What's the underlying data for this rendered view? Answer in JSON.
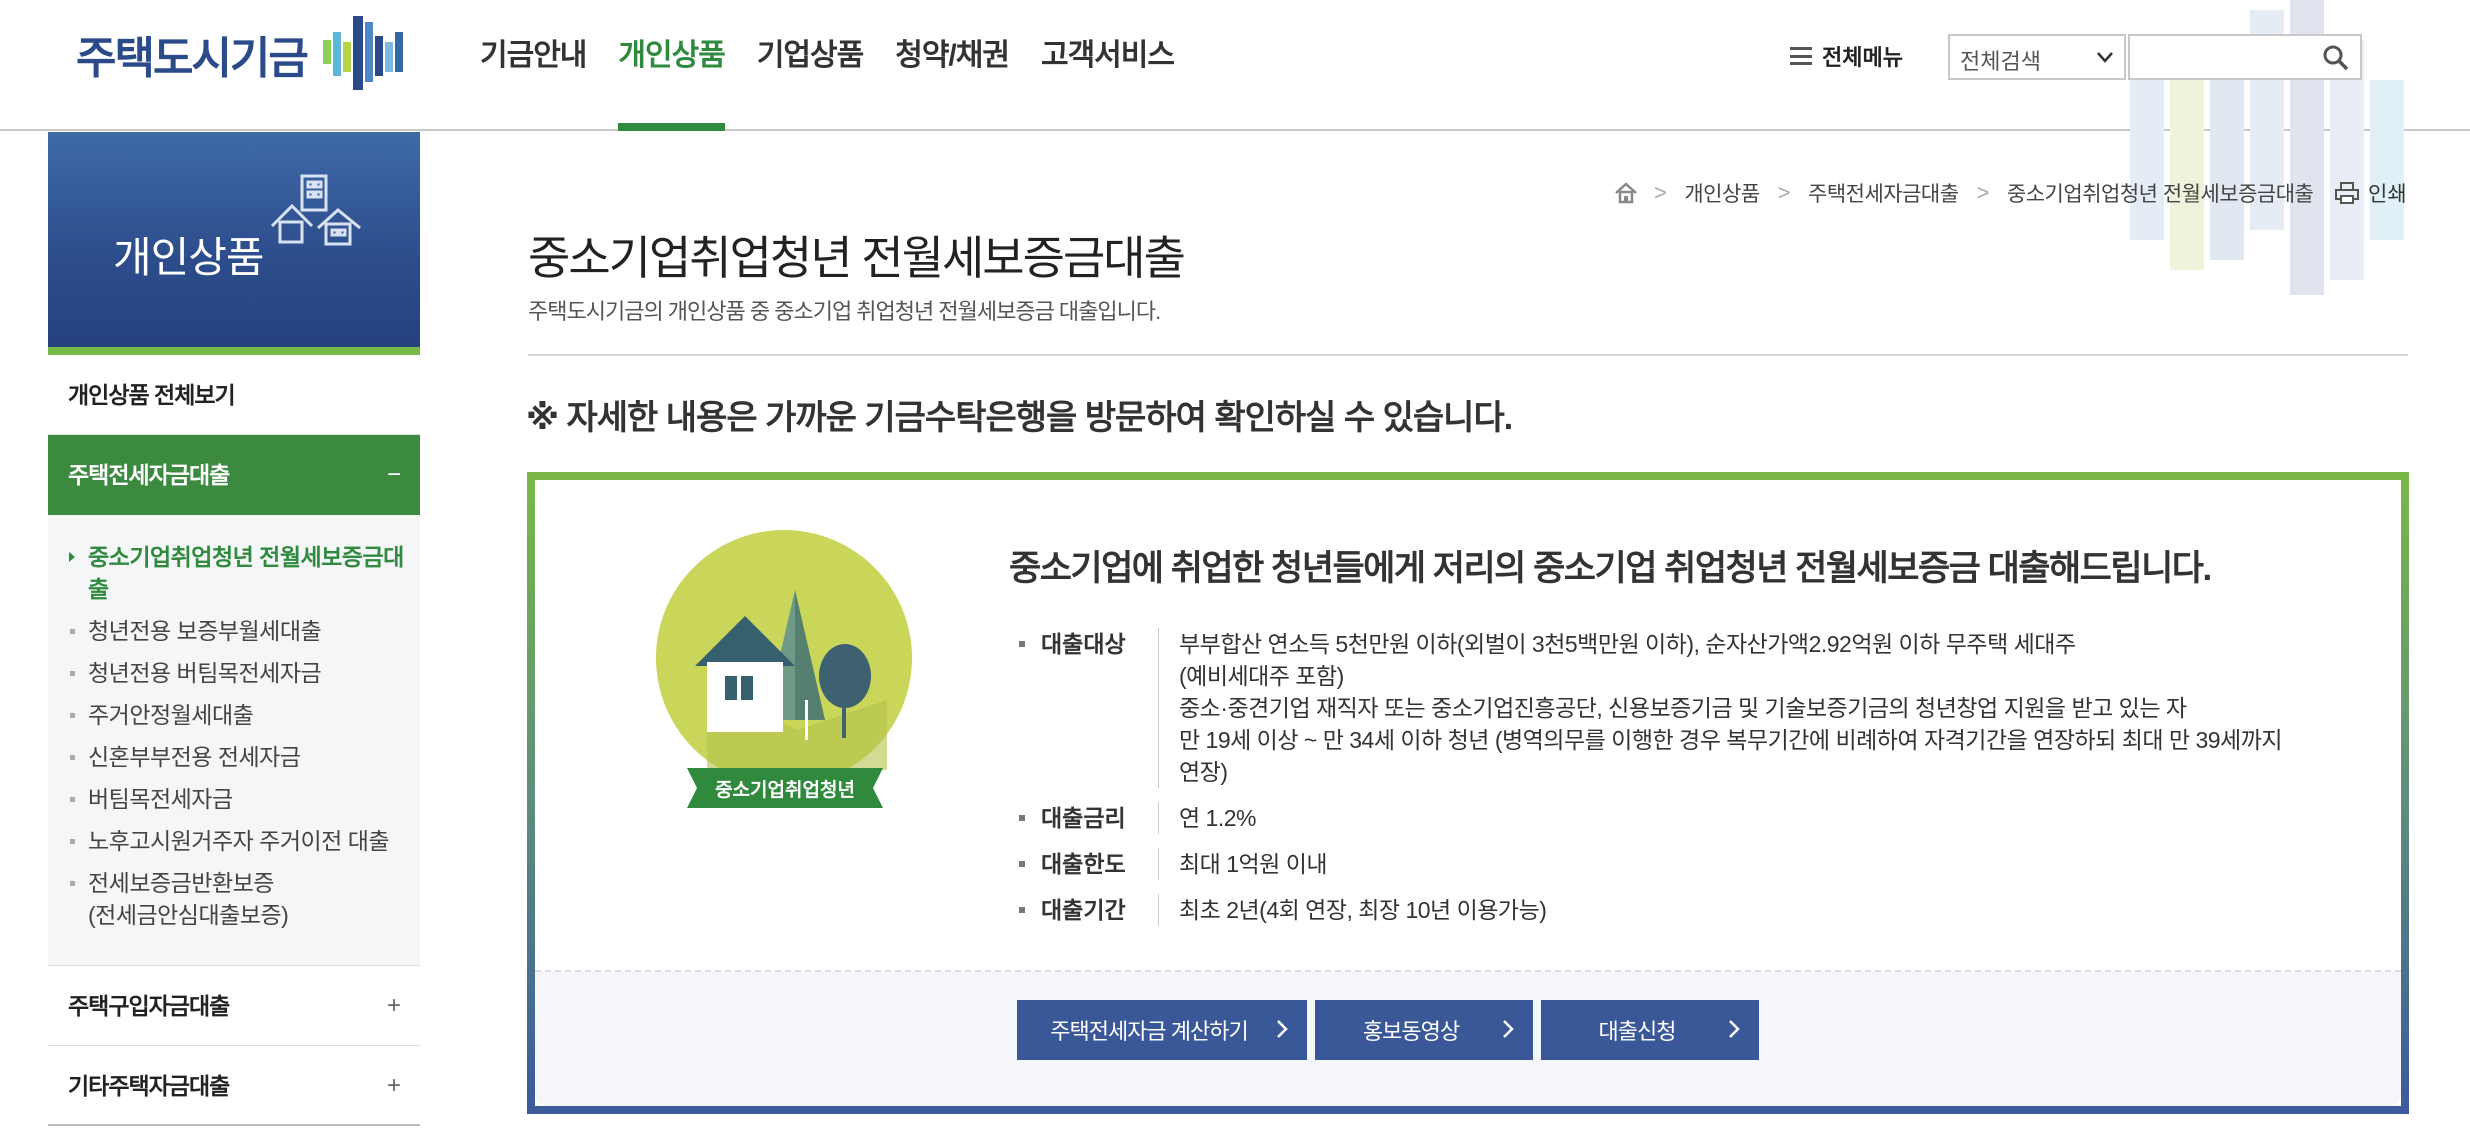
{
  "header": {
    "logo_text": "주택도시기금",
    "nav": [
      "기금안내",
      "개인상품",
      "기업상품",
      "청약/채권",
      "고객서비스"
    ],
    "active_nav": "개인상품",
    "all_menu_label": "전체메뉴",
    "search_select_value": "전체검색",
    "search_input_value": "",
    "icons": [
      "menu-icon",
      "chevron-down-icon",
      "search-icon"
    ]
  },
  "sidebar": {
    "title": "개인상품",
    "all_view": "개인상품 전체보기",
    "groups": [
      {
        "label": "주택전세자금대출",
        "sign": "−",
        "open": true,
        "items": [
          {
            "label": "중소기업취업청년 전월세보증금대출",
            "current": true
          },
          {
            "label": "청년전용 보증부월세대출"
          },
          {
            "label": "청년전용 버팀목전세자금"
          },
          {
            "label": "주거안정월세대출"
          },
          {
            "label": "신혼부부전용 전세자금"
          },
          {
            "label": "버팀목전세자금"
          },
          {
            "label": "노후고시원거주자 주거이전 대출"
          },
          {
            "label": "전세보증금반환보증(전세금안심대출보증)"
          }
        ]
      },
      {
        "label": "주택구입자금대출",
        "sign": "+",
        "open": false
      },
      {
        "label": "기타주택자금대출",
        "sign": "+",
        "open": false
      }
    ]
  },
  "breadcrumb": [
    "개인상품",
    "주택전세자금대출",
    "중소기업취업청년 전월세보증금대출"
  ],
  "print_label": "인쇄",
  "page": {
    "title": "중소기업취업청년 전월세보증금대출",
    "description": "주택도시기금의 개인상품 중 중소기업 취업청년 전월세보증금 대출입니다.",
    "notice": "※ 자세한 내용은 가까운 기금수탁은행을 방문하여 확인하실 수 있습니다."
  },
  "product": {
    "badge_label": "중소기업취업청년",
    "headline": "중소기업에 취업한 청년들에게 저리의 중소기업 취업청년 전월세보증금 대출해드립니다.",
    "info": [
      {
        "label": "대출대상",
        "values": [
          "부부합산 연소득 5천만원 이하(외벌이 3천5백만원 이하), 순자산가액2.92억원 이하 무주택 세대주",
          "(예비세대주 포함)",
          "중소·중견기업 재직자 또는 중소기업진흥공단, 신용보증기금 및 기술보증기금의 청년창업 지원을 받고 있는 자",
          "만 19세 이상 ~ 만 34세 이하 청년 (병역의무를 이행한 경우 복무기간에 비례하여 자격기간을 연장하되 최대 만 39세까지",
          "연장)"
        ]
      },
      {
        "label": "대출금리",
        "values": [
          "연 1.2%"
        ]
      },
      {
        "label": "대출한도",
        "values": [
          "최대 1억원 이내"
        ]
      },
      {
        "label": "대출기간",
        "values": [
          "최초 2년(4회 연장, 최장 10년 이용가능)"
        ]
      }
    ],
    "buttons": [
      "주택전세자금 계산하기",
      "홍보동영상",
      "대출신청"
    ]
  },
  "colors": {
    "brand_green": "#2f8a3e",
    "brand_navy": "#2c4c8b",
    "button_blue": "#3a5898",
    "badge_lime": "#c9d65a"
  }
}
